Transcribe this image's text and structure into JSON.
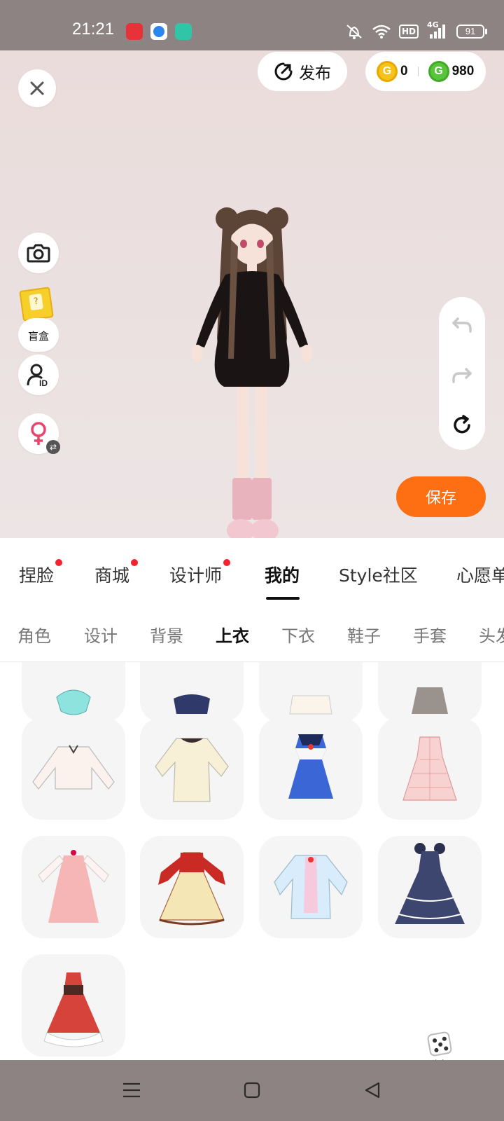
{
  "status_bar": {
    "time": "21:21",
    "hd_label": "HD",
    "network": "4G",
    "battery": "91",
    "app_icons": [
      "video-app-icon",
      "browser-app-icon",
      "chat-app-icon"
    ],
    "icons": [
      "mute-bell-icon",
      "wifi-icon",
      "signal-icon",
      "battery-icon"
    ]
  },
  "header": {
    "publish_label": "发布",
    "gold_coin_count": "0",
    "green_coin_count": "980",
    "gold_coin_glyph": "G",
    "green_coin_glyph": "G"
  },
  "side_tools": {
    "blind_box_label": "盲盒",
    "id_label": "ID"
  },
  "actions": {
    "save_label": "保存",
    "random_label": "随机"
  },
  "main_tabs": [
    {
      "label": "捏脸",
      "dot": true
    },
    {
      "label": "商城",
      "dot": true
    },
    {
      "label": "设计师",
      "dot": true
    },
    {
      "label": "我的",
      "active": true
    },
    {
      "label": "Style社区"
    },
    {
      "label": "心愿单"
    }
  ],
  "sub_tabs": [
    {
      "label": "角色"
    },
    {
      "label": "设计"
    },
    {
      "label": "背景"
    },
    {
      "label": "上衣",
      "active": true
    },
    {
      "label": "下衣"
    },
    {
      "label": "鞋子"
    },
    {
      "label": "手套"
    },
    {
      "label": "头发"
    }
  ],
  "items": [
    {
      "name": "mint-top-item"
    },
    {
      "name": "navy-top-item"
    },
    {
      "name": "cream-top-item"
    },
    {
      "name": "grey-skirt-dress-item"
    },
    {
      "name": "white-blouse-item"
    },
    {
      "name": "cream-sweater-dress-item"
    },
    {
      "name": "blue-sailor-dress-item"
    },
    {
      "name": "pink-plaid-dress-item"
    },
    {
      "name": "pink-ruffle-dress-item"
    },
    {
      "name": "red-cream-lolita-dress-item"
    },
    {
      "name": "pastel-jacket-item"
    },
    {
      "name": "navy-layered-dress-item"
    },
    {
      "name": "red-white-ruffle-dress-item"
    }
  ],
  "colors": {
    "accent": "#fd6f12",
    "badge": "#f5222d",
    "bar": "#8c8382",
    "scene": "#ebe1e1"
  }
}
